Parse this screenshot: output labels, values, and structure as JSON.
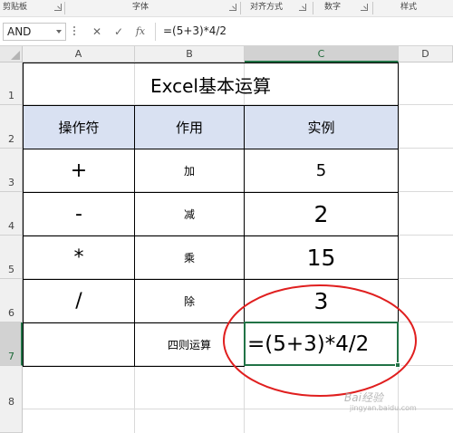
{
  "ribbon": {
    "groups": [
      {
        "label": "剪贴板"
      },
      {
        "label": "字体"
      },
      {
        "label": "对齐方式"
      },
      {
        "label": "数字"
      },
      {
        "label": "样式"
      }
    ]
  },
  "formula_bar": {
    "name_box": "AND",
    "cancel_glyph": "✕",
    "enter_glyph": "✓",
    "fx_glyph": "fx",
    "formula": "=(5+3)*4/2"
  },
  "columns": [
    "A",
    "B",
    "C",
    "D"
  ],
  "rows": [
    "1",
    "2",
    "3",
    "4",
    "5",
    "6",
    "7",
    "8"
  ],
  "sheet": {
    "title": "Excel基本运算",
    "headers": [
      "操作符",
      "作用",
      "实例"
    ],
    "rows": [
      {
        "operator": "+",
        "action": "加",
        "example": "5"
      },
      {
        "operator": "-",
        "action": "减",
        "example": "2"
      },
      {
        "operator": "*",
        "action": "乘",
        "example": "15"
      },
      {
        "operator": "/",
        "action": "除",
        "example": "3"
      }
    ],
    "row7_label": "四则运算",
    "row7_formula": "=(5+3)*4/2"
  },
  "annotation": {
    "ellipse_color": "#e01f1f"
  },
  "watermark": {
    "text": "Bai经验",
    "subtext": "jingyan.baidu.com"
  },
  "colors": {
    "header_fill": "#d9e1f2",
    "excel_green": "#217346"
  }
}
